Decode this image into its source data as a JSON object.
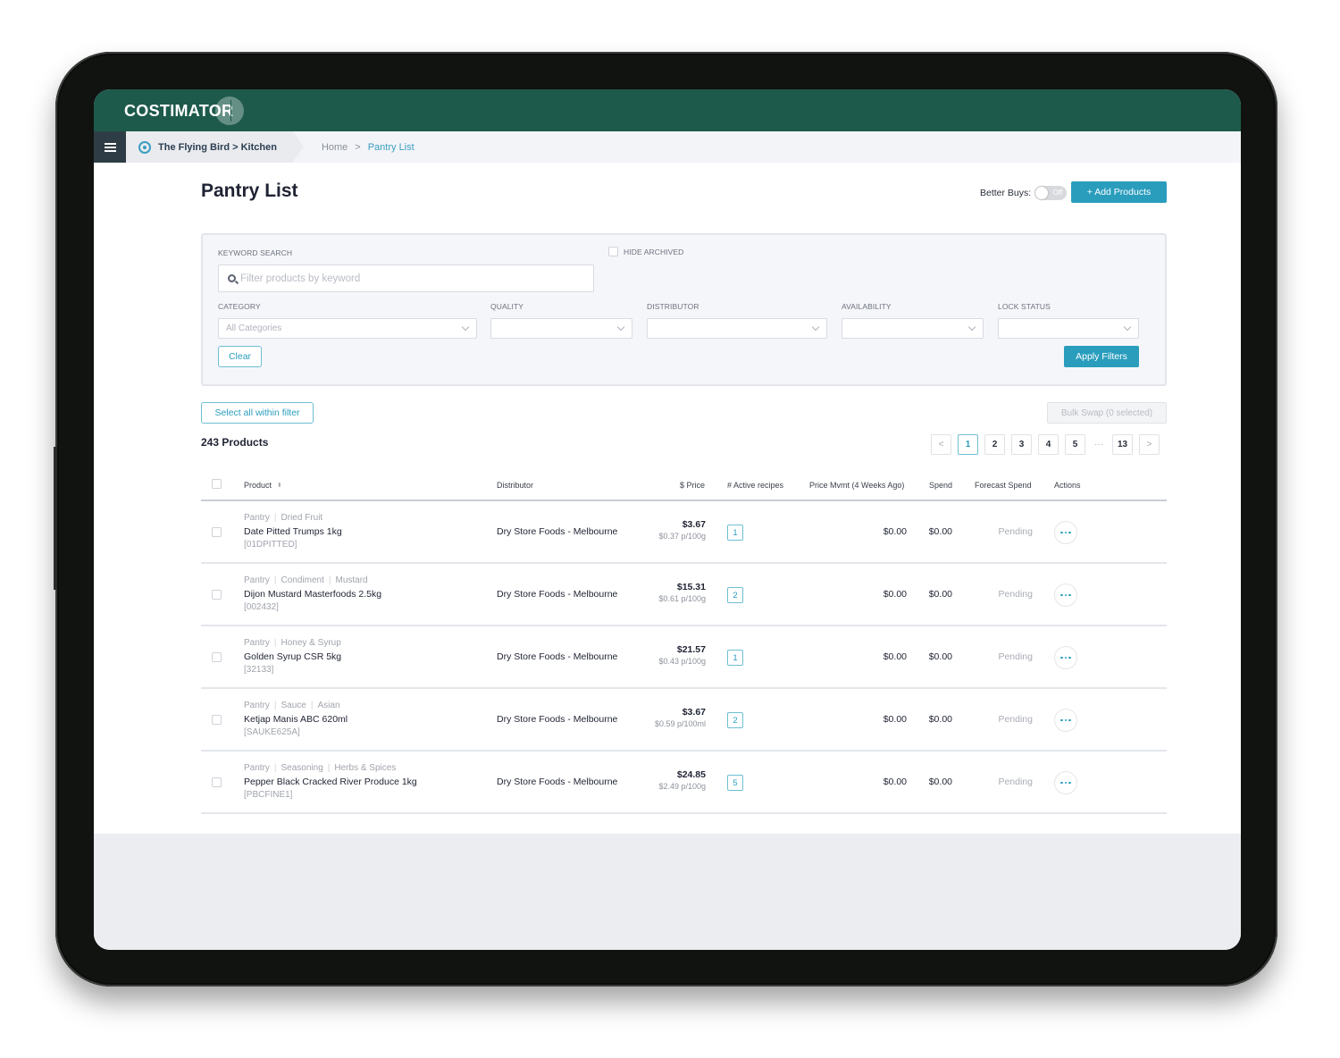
{
  "app": {
    "name": "COSTIMATOR"
  },
  "breadcrumb": {
    "location": "The Flying Bird > Kitchen",
    "items": [
      "Home",
      "Pantry List"
    ],
    "separator": ">"
  },
  "page": {
    "title": "Pantry List"
  },
  "better_buys": {
    "label": "Better Buys:",
    "state": "Off"
  },
  "toolbar": {
    "add_products": "+  Add Products"
  },
  "filters": {
    "keyword_label": "Keyword Search",
    "keyword_placeholder": "Filter products by keyword",
    "keyword_value": "",
    "hide_archived_label": "Hide Archived",
    "category_label": "Category",
    "category_value": "All Categories",
    "quality_label": "Quality",
    "distributor_label": "Distributor",
    "availability_label": "Availability",
    "lock_status_label": "Lock Status",
    "clear": "Clear",
    "apply": "Apply Filters"
  },
  "list": {
    "select_all": "Select all within filter",
    "bulk_swap": "Bulk Swap (0 selected)",
    "count": "243 Products"
  },
  "pagination": {
    "prev": "<",
    "pages": [
      "1",
      "2",
      "3",
      "4",
      "5"
    ],
    "ellipsis": "···",
    "last": "13",
    "next": ">",
    "current": "1"
  },
  "table": {
    "headers": {
      "product": "Product",
      "distributor": "Distributor",
      "price": "$ Price",
      "recipes": "# Active recipes",
      "mvmt": "Price Mvmt (4 Weeks Ago)",
      "spend": "Spend",
      "forecast": "Forecast Spend",
      "actions": "Actions"
    },
    "rows": [
      {
        "cats": [
          "Pantry",
          "Dried Fruit"
        ],
        "name": "Date Pitted Trumps 1kg",
        "code": "[01DPITTED]",
        "distributor": "Dry Store Foods - Melbourne",
        "price": "$3.67",
        "unit_price": "$0.37 p/100g",
        "recipes": "1",
        "mvmt": "$0.00",
        "spend": "$0.00",
        "forecast": "Pending"
      },
      {
        "cats": [
          "Pantry",
          "Condiment",
          "Mustard"
        ],
        "name": "Dijon Mustard Masterfoods 2.5kg",
        "code": "[002432]",
        "distributor": "Dry Store Foods - Melbourne",
        "price": "$15.31",
        "unit_price": "$0.61 p/100g",
        "recipes": "2",
        "mvmt": "$0.00",
        "spend": "$0.00",
        "forecast": "Pending"
      },
      {
        "cats": [
          "Pantry",
          "Honey & Syrup"
        ],
        "name": "Golden Syrup CSR 5kg",
        "code": "[32133]",
        "distributor": "Dry Store Foods - Melbourne",
        "price": "$21.57",
        "unit_price": "$0.43 p/100g",
        "recipes": "1",
        "mvmt": "$0.00",
        "spend": "$0.00",
        "forecast": "Pending"
      },
      {
        "cats": [
          "Pantry",
          "Sauce",
          "Asian"
        ],
        "name": "Ketjap Manis ABC 620ml",
        "code": "[SAUKE625A]",
        "distributor": "Dry Store Foods - Melbourne",
        "price": "$3.67",
        "unit_price": "$0.59 p/100ml",
        "recipes": "2",
        "mvmt": "$0.00",
        "spend": "$0.00",
        "forecast": "Pending"
      },
      {
        "cats": [
          "Pantry",
          "Seasoning",
          "Herbs & Spices"
        ],
        "name": "Pepper Black Cracked River Produce 1kg",
        "code": "[PBCFINE1]",
        "distributor": "Dry Store Foods - Melbourne",
        "price": "$24.85",
        "unit_price": "$2.49 p/100g",
        "recipes": "5",
        "mvmt": "$0.00",
        "spend": "$0.00",
        "forecast": "Pending"
      }
    ]
  },
  "colors": {
    "brand_green": "#1d5a4b",
    "accent_teal": "#2a9dbd",
    "nav_dark": "#2e3d45"
  }
}
